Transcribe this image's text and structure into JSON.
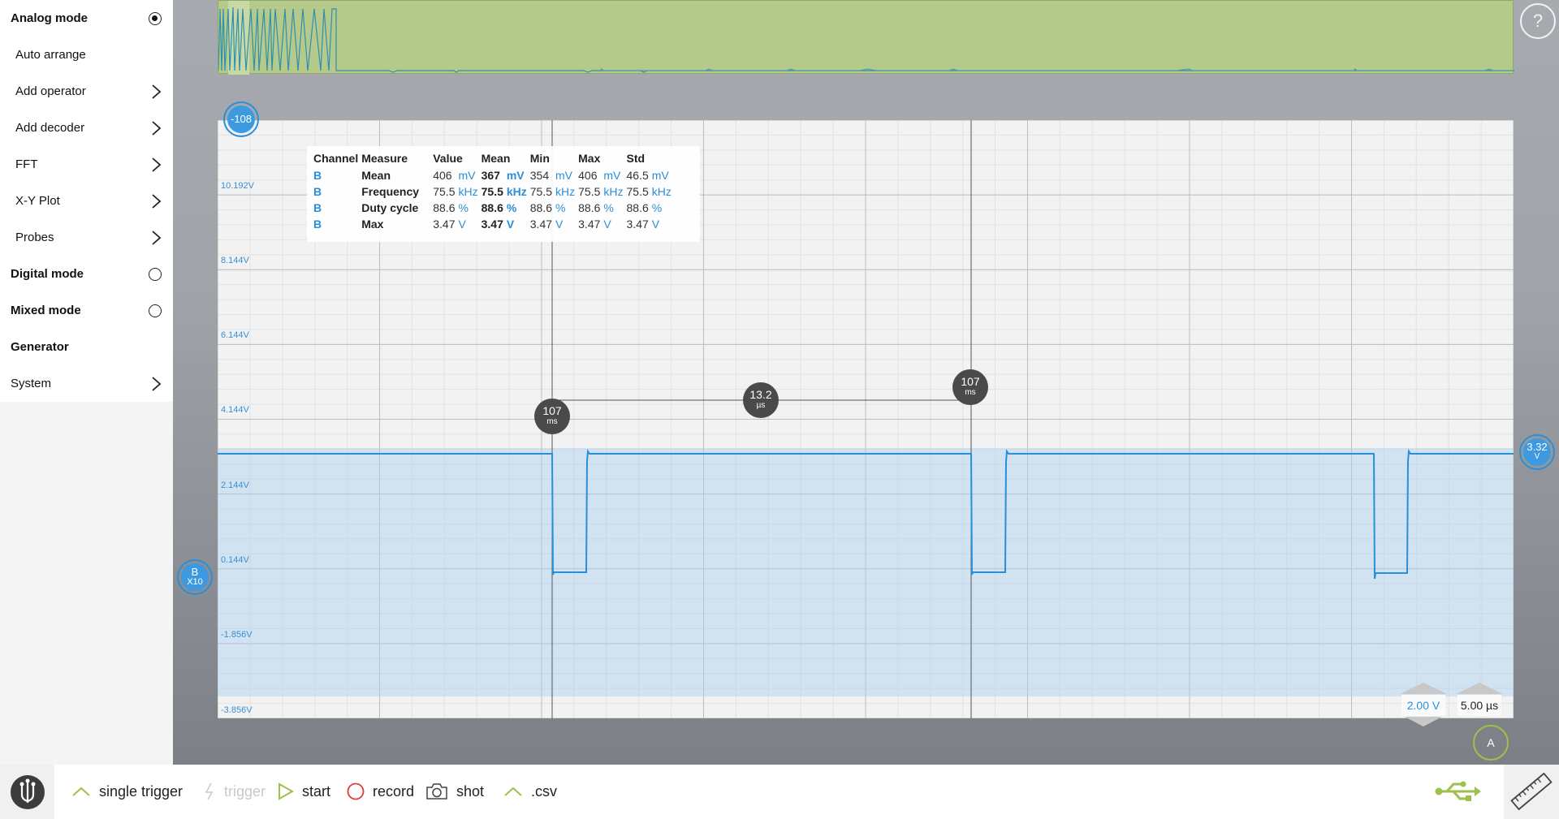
{
  "sidebar": {
    "items": [
      {
        "label": "Analog mode",
        "type": "radio",
        "selected": true
      },
      {
        "label": "Auto arrange",
        "type": "action"
      },
      {
        "label": "Add operator",
        "type": "submenu"
      },
      {
        "label": "Add decoder",
        "type": "submenu"
      },
      {
        "label": "FFT",
        "type": "submenu"
      },
      {
        "label": "X-Y Plot",
        "type": "submenu"
      },
      {
        "label": "Probes",
        "type": "submenu"
      },
      {
        "label": "Digital mode",
        "type": "radio",
        "selected": false
      },
      {
        "label": "Mixed mode",
        "type": "radio",
        "selected": false
      },
      {
        "label": "Generator",
        "type": "header"
      },
      {
        "label": "System",
        "type": "submenu"
      }
    ]
  },
  "help_label": "?",
  "y_axis_labels": [
    "10.192V",
    "8.144V",
    "6.144V",
    "4.144V",
    "2.144V",
    "0.144V",
    "-1.856V",
    "-3.856V"
  ],
  "measurements": {
    "headers": [
      "Channel",
      "Measure",
      "Value",
      "Mean",
      "Min",
      "Max",
      "Std"
    ],
    "rows": [
      {
        "channel": "B",
        "measure": "Mean",
        "value": "406",
        "value_unit": "mV",
        "mean": "367",
        "mean_unit": "mV",
        "min": "354",
        "min_unit": "mV",
        "max": "406",
        "max_unit": "mV",
        "std": "46.5",
        "std_unit": "mV"
      },
      {
        "channel": "B",
        "measure": "Frequency",
        "value": "75.5",
        "value_unit": "kHz",
        "mean": "75.5",
        "mean_unit": "kHz",
        "min": "75.5",
        "min_unit": "kHz",
        "max": "75.5",
        "max_unit": "kHz",
        "std": "75.5",
        "std_unit": "kHz"
      },
      {
        "channel": "B",
        "measure": "Duty cycle",
        "value": "88.6",
        "value_unit": "%",
        "mean": "88.6",
        "mean_unit": "%",
        "min": "88.6",
        "min_unit": "%",
        "max": "88.6",
        "max_unit": "%",
        "std": "88.6",
        "std_unit": "%"
      },
      {
        "channel": "B",
        "measure": "Max",
        "value": "3.47",
        "value_unit": "V",
        "mean": "3.47",
        "mean_unit": "V",
        "min": "3.47",
        "min_unit": "V",
        "max": "3.47",
        "max_unit": "V",
        "std": "3.47",
        "std_unit": "V"
      }
    ]
  },
  "cursors": {
    "left": {
      "value": "107",
      "unit": "ms"
    },
    "delta": {
      "value": "13.2",
      "unit": "µs"
    },
    "right": {
      "value": "107",
      "unit": "ms"
    }
  },
  "markers": {
    "time_offset": "-108",
    "channel": {
      "name": "B",
      "probe": "X10"
    },
    "trigger_level": {
      "value": "3.32",
      "unit": "V"
    },
    "trigger_source": "A"
  },
  "scales": {
    "voltage": "2.00 V",
    "time": "5.00 µs"
  },
  "toolbar": {
    "single_trigger": "single trigger",
    "trigger": "trigger",
    "start": "start",
    "record": "record",
    "shot": "shot",
    "csv": ".csv"
  },
  "colors": {
    "accent_blue": "#2a8fd8",
    "accent_green": "#9dc14a",
    "overview_bg": "#b4c98a",
    "plot_bg": "#f2f2f2"
  }
}
